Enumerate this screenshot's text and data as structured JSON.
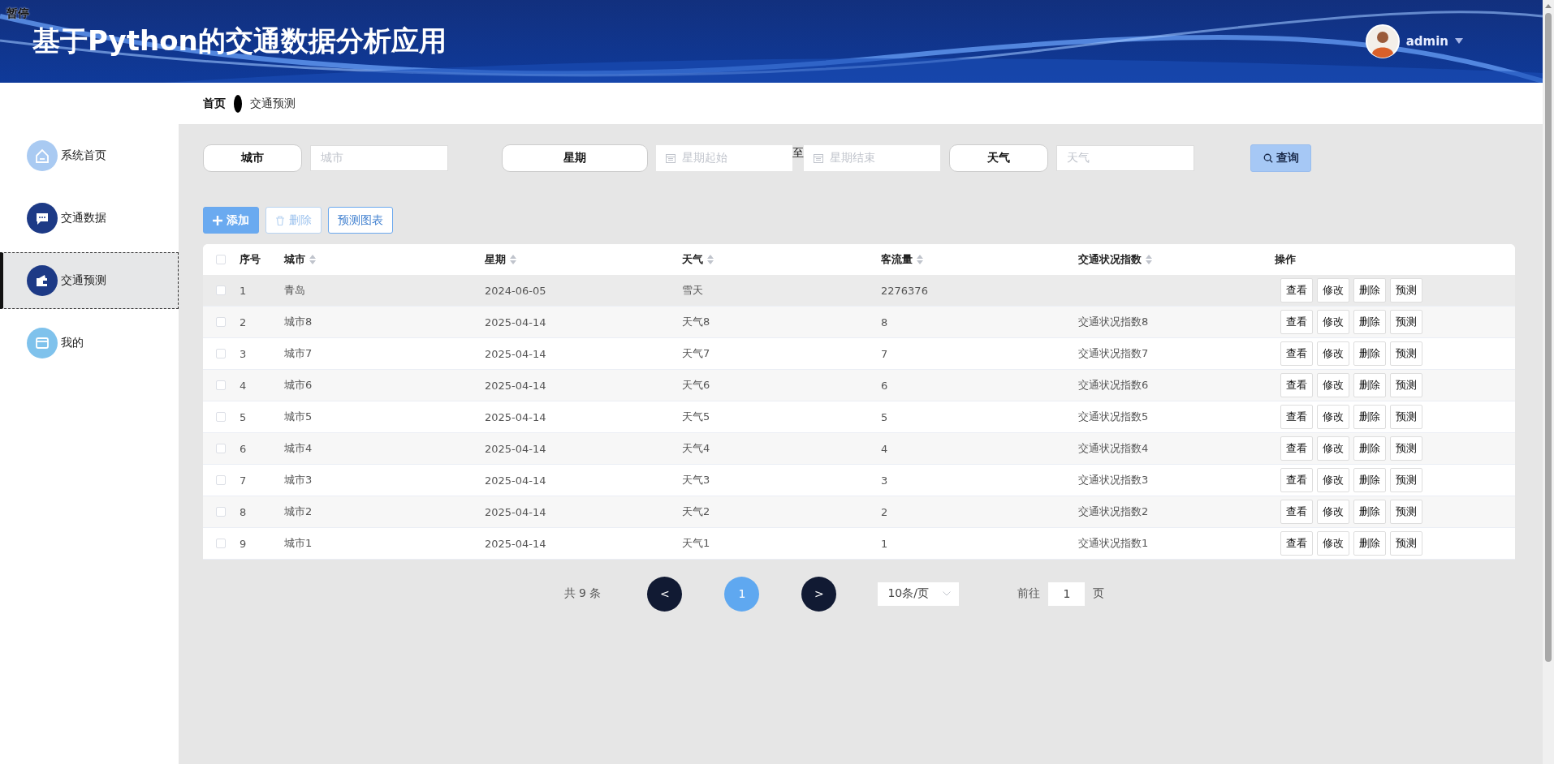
{
  "overlay_label": "暂停",
  "header": {
    "title": "基于Python的交通数据分析应用",
    "user": {
      "name": "admin"
    }
  },
  "breadcrumb": [
    {
      "label": "首页",
      "current": false
    },
    {
      "label": "交通预测",
      "current": true
    }
  ],
  "sidebar": {
    "items": [
      {
        "label": "系统首页",
        "kind": "home",
        "color": "#a9caf2",
        "selected": false
      },
      {
        "label": "交通数据",
        "kind": "chat",
        "color": "#1d3a86",
        "selected": false
      },
      {
        "label": "交通预测",
        "kind": "wallet",
        "color": "#1d3a86",
        "selected": true
      },
      {
        "label": "我的",
        "kind": "card",
        "color": "#7fc2ec",
        "selected": false
      }
    ]
  },
  "filters": [
    {
      "kind": "text",
      "label": "城市",
      "placeholder": "城市"
    },
    {
      "kind": "daterange",
      "label": "星期",
      "start_placeholder": "星期起始",
      "separator": "至",
      "end_placeholder": "星期结束"
    },
    {
      "kind": "text",
      "label": "天气",
      "placeholder": "天气"
    }
  ],
  "search_button": "查询",
  "toolbar": [
    {
      "label": "添加",
      "kind": "add",
      "disabled": false
    },
    {
      "label": "删除",
      "kind": "delete",
      "disabled": true
    },
    {
      "label": "预测图表",
      "kind": "plain",
      "disabled": false
    }
  ],
  "table": {
    "select_all": {
      "checked": false
    },
    "columns": [
      {
        "label": "序号",
        "sortable": false
      },
      {
        "label": "城市",
        "sortable": true
      },
      {
        "label": "星期",
        "sortable": true
      },
      {
        "label": "天气",
        "sortable": true
      },
      {
        "label": "客流量",
        "sortable": true
      },
      {
        "label": "交通状况指数",
        "sortable": true
      },
      {
        "label": "操作",
        "sortable": false
      }
    ],
    "rows": [
      {
        "checked": false,
        "hovered": true,
        "index": "1",
        "city": "青岛",
        "weekday": "2024-06-05",
        "weather": "雪天",
        "passenger_flow": "2276376",
        "actions": [
          "查看",
          "修改",
          "删除",
          "预测"
        ]
      },
      {
        "checked": false,
        "hovered": false,
        "index": "2",
        "city": "城市8",
        "weekday": "2025-04-14",
        "weather": "天气8",
        "passenger_flow": "8",
        "traffic_index": "交通状况指数8",
        "actions": [
          "查看",
          "修改",
          "删除",
          "预测"
        ]
      },
      {
        "checked": false,
        "hovered": false,
        "index": "3",
        "city": "城市7",
        "weekday": "2025-04-14",
        "weather": "天气7",
        "passenger_flow": "7",
        "traffic_index": "交通状况指数7",
        "actions": [
          "查看",
          "修改",
          "删除",
          "预测"
        ]
      },
      {
        "checked": false,
        "hovered": false,
        "index": "4",
        "city": "城市6",
        "weekday": "2025-04-14",
        "weather": "天气6",
        "passenger_flow": "6",
        "traffic_index": "交通状况指数6",
        "actions": [
          "查看",
          "修改",
          "删除",
          "预测"
        ]
      },
      {
        "checked": false,
        "hovered": false,
        "index": "5",
        "city": "城市5",
        "weekday": "2025-04-14",
        "weather": "天气5",
        "passenger_flow": "5",
        "traffic_index": "交通状况指数5",
        "actions": [
          "查看",
          "修改",
          "删除",
          "预测"
        ]
      },
      {
        "checked": false,
        "hovered": false,
        "index": "6",
        "city": "城市4",
        "weekday": "2025-04-14",
        "weather": "天气4",
        "passenger_flow": "4",
        "traffic_index": "交通状况指数4",
        "actions": [
          "查看",
          "修改",
          "删除",
          "预测"
        ]
      },
      {
        "checked": false,
        "hovered": false,
        "index": "7",
        "city": "城市3",
        "weekday": "2025-04-14",
        "weather": "天气3",
        "passenger_flow": "3",
        "traffic_index": "交通状况指数3",
        "actions": [
          "查看",
          "修改",
          "删除",
          "预测"
        ]
      },
      {
        "checked": false,
        "hovered": false,
        "index": "8",
        "city": "城市2",
        "weekday": "2025-04-14",
        "weather": "天气2",
        "passenger_flow": "2",
        "traffic_index": "交通状况指数2",
        "actions": [
          "查看",
          "修改",
          "删除",
          "预测"
        ]
      },
      {
        "checked": false,
        "hovered": false,
        "index": "9",
        "city": "城市1",
        "weekday": "2025-04-14",
        "weather": "天气1",
        "passenger_flow": "1",
        "traffic_index": "交通状况指数1",
        "actions": [
          "查看",
          "修改",
          "删除",
          "预测"
        ]
      }
    ]
  },
  "pagination": {
    "total": "共 9 条",
    "prev": "<",
    "pages": [
      {
        "label": "1",
        "selected": true
      }
    ],
    "next": ">",
    "page_size": "10条/页",
    "goto_label": "前往",
    "goto_value": "1",
    "goto_suffix": "页"
  }
}
